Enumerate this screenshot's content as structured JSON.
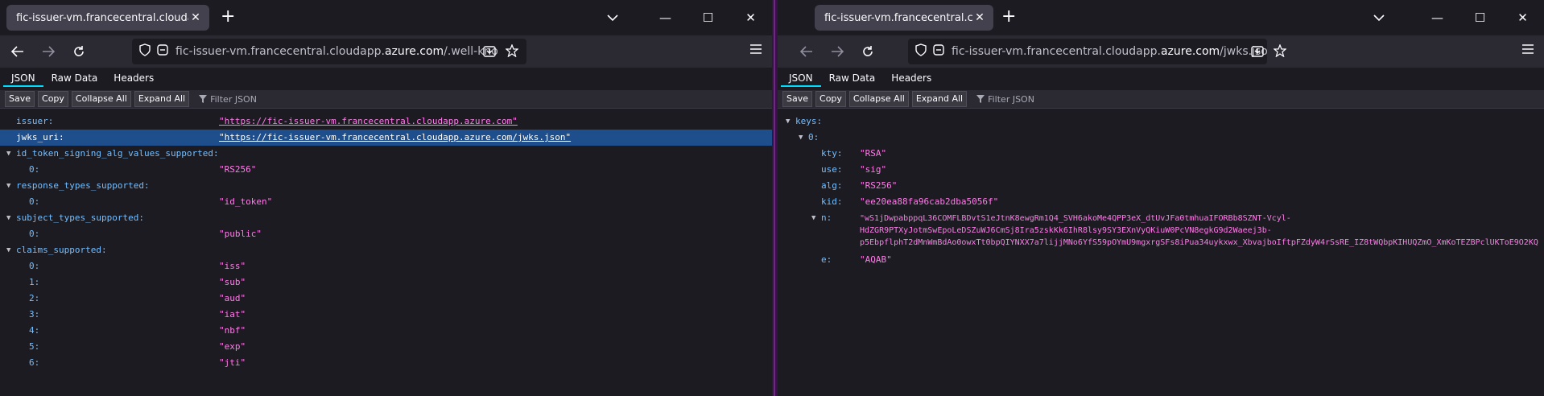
{
  "left": {
    "tab_title": "fic-issuer-vm.francecentral.cloudapp.azure.com/.well-known/openid-configuration",
    "url_prefix": "fic-issuer-vm.francecentral.cloudapp.",
    "url_domain": "azure.com",
    "url_path": "/.well-known/openid-configuration",
    "json_tabs": [
      "JSON",
      "Raw Data",
      "Headers"
    ],
    "toolbar": {
      "save": "Save",
      "copy": "Copy",
      "collapse": "Collapse All",
      "expand": "Expand All",
      "filter_placeholder": "Filter JSON"
    },
    "rows": {
      "issuer": {
        "key": "issuer:",
        "value": "\"https://fic-issuer-vm.francecentral.cloudapp.azure.com\""
      },
      "jwks_uri": {
        "key": "jwks_uri:",
        "value": "\"https://fic-issuer-vm.francecentral.cloudapp.azure.com/jwks.json\""
      },
      "alg_values": {
        "key": "id_token_signing_alg_values_supported:",
        "items": [
          {
            "key": "0:",
            "value": "\"RS256\""
          }
        ]
      },
      "response_types": {
        "key": "response_types_supported:",
        "items": [
          {
            "key": "0:",
            "value": "\"id_token\""
          }
        ]
      },
      "subject_types": {
        "key": "subject_types_supported:",
        "items": [
          {
            "key": "0:",
            "value": "\"public\""
          }
        ]
      },
      "claims": {
        "key": "claims_supported:",
        "items": [
          {
            "key": "0:",
            "value": "\"iss\""
          },
          {
            "key": "1:",
            "value": "\"sub\""
          },
          {
            "key": "2:",
            "value": "\"aud\""
          },
          {
            "key": "3:",
            "value": "\"iat\""
          },
          {
            "key": "4:",
            "value": "\"nbf\""
          },
          {
            "key": "5:",
            "value": "\"exp\""
          },
          {
            "key": "6:",
            "value": "\"jti\""
          }
        ]
      }
    }
  },
  "right": {
    "tab_title": "fic-issuer-vm.francecentral.cloudapp.azure.com/jwks.json",
    "url_prefix": "fic-issuer-vm.francecentral.cloudapp.",
    "url_domain": "azure.com",
    "url_path": "/jwks.json",
    "json_tabs": [
      "JSON",
      "Raw Data",
      "Headers"
    ],
    "toolbar": {
      "save": "Save",
      "copy": "Copy",
      "collapse": "Collapse All",
      "expand": "Expand All",
      "filter_placeholder": "Filter JSON"
    },
    "keys_label": "keys:",
    "index_label": "0:",
    "fields": {
      "kty": {
        "key": "kty:",
        "value": "\"RSA\""
      },
      "use": {
        "key": "use:",
        "value": "\"sig\""
      },
      "alg": {
        "key": "alg:",
        "value": "\"RS256\""
      },
      "kid": {
        "key": "kid:",
        "value": "\"ee20ea88fa96cab2dba5056f\""
      },
      "n": {
        "key": "n:",
        "lines": [
          "\"wS1jDwpabppqL36COMFLBDvtS1eJtnK8ewgRm1Q4_SVH6akoMe4QPP3eX_dtUvJFa0tmhuaIFORBb8SZNT-Vcyl-",
          "HdZGR9PTXyJotmSwEpoLeDSZuWJ6CmSj8Ira5zskKk6IhR8lsy9SY3EXnVyQKiuW0PcVN8egkG9d2Waeej3b-",
          "p5EbpflphT2dMnWmBdAo0owxTt0bpQIYNXX7a7lijjMNo6YfS59pOYmU9mgxrgSFs8iPua34uykxwx_XbvajboIftpFZdyW4rSsRE_IZ8tWQbpKIHUQZmO_XmKoTEZBPclUKToE9O2KQ"
        ]
      },
      "e": {
        "key": "e:",
        "value": "\"AQAB\""
      }
    }
  }
}
